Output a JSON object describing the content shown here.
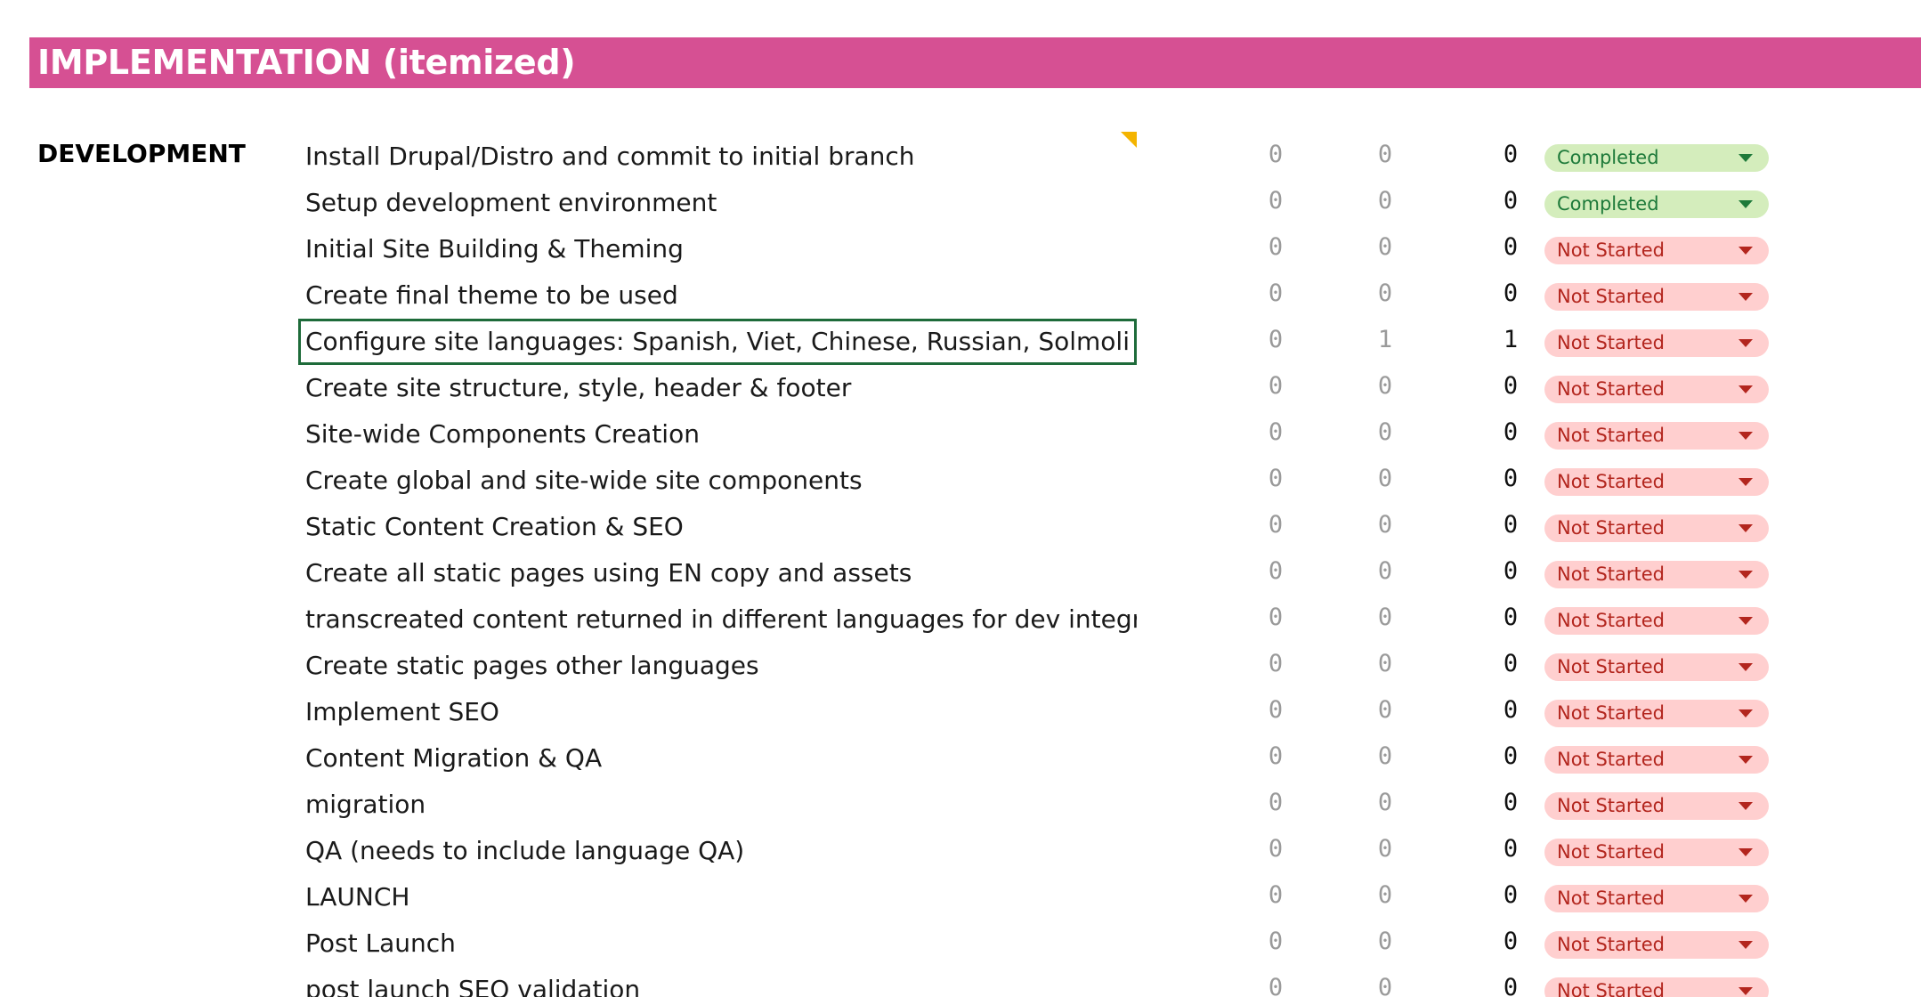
{
  "header": {
    "title": "IMPLEMENTATION (itemized)",
    "background": "#d65093"
  },
  "section": {
    "label": "DEVELOPMENT"
  },
  "status_colors": {
    "not_started_bg": "#ffcfcf",
    "not_started_text": "#b3261e",
    "completed_bg": "#d4edbc",
    "completed_text": "#1e7a3a"
  },
  "rows": [
    {
      "task": "Install Drupal/Distro and commit to initial branch",
      "col1": "0",
      "col2": "0",
      "col3": "0",
      "status": "Completed"
    },
    {
      "task": "Setup development environment",
      "col1": "0",
      "col2": "0",
      "col3": "0",
      "status": "Completed"
    },
    {
      "task": "Initial Site Building & Theming",
      "col1": "0",
      "col2": "0",
      "col3": "0",
      "status": "Not Started"
    },
    {
      "task": "Create final theme to be used",
      "col1": "0",
      "col2": "0",
      "col3": "0",
      "status": "Not Started"
    },
    {
      "task": "Configure site languages:  Spanish, Viet, Chinese, Russian, Solmoli",
      "col1": "0",
      "col2": "1",
      "col3": "1",
      "status": "Not Started",
      "selected": true
    },
    {
      "task": "Create site structure, style, header & footer",
      "col1": "0",
      "col2": "0",
      "col3": "0",
      "status": "Not Started"
    },
    {
      "task": "Site-wide Components Creation",
      "col1": "0",
      "col2": "0",
      "col3": "0",
      "status": "Not Started"
    },
    {
      "task": "Create global and site-wide site components",
      "col1": "0",
      "col2": "0",
      "col3": "0",
      "status": "Not Started"
    },
    {
      "task": "Static Content Creation & SEO",
      "col1": "0",
      "col2": "0",
      "col3": "0",
      "status": "Not Started"
    },
    {
      "task": "Create all static pages using EN copy and assets",
      "col1": "0",
      "col2": "0",
      "col3": "0",
      "status": "Not Started"
    },
    {
      "task": "transcreated content returned in different languages for dev integration",
      "col1": "0",
      "col2": "0",
      "col3": "0",
      "status": "Not Started"
    },
    {
      "task": "Create static pages other languages",
      "col1": "0",
      "col2": "0",
      "col3": "0",
      "status": "Not Started"
    },
    {
      "task": "Implement SEO",
      "col1": "0",
      "col2": "0",
      "col3": "0",
      "status": "Not Started"
    },
    {
      "task": "Content Migration & QA",
      "col1": "0",
      "col2": "0",
      "col3": "0",
      "status": "Not Started"
    },
    {
      "task": "migration",
      "col1": "0",
      "col2": "0",
      "col3": "0",
      "status": "Not Started"
    },
    {
      "task": "QA (needs to include language QA)",
      "col1": "0",
      "col2": "0",
      "col3": "0",
      "status": "Not Started"
    },
    {
      "task": "LAUNCH",
      "col1": "0",
      "col2": "0",
      "col3": "0",
      "status": "Not Started"
    },
    {
      "task": "Post Launch",
      "col1": "0",
      "col2": "0",
      "col3": "0",
      "status": "Not Started"
    },
    {
      "task": "post launch SEO validation",
      "col1": "0",
      "col2": "0",
      "col3": "0",
      "status": "Not Started"
    }
  ]
}
